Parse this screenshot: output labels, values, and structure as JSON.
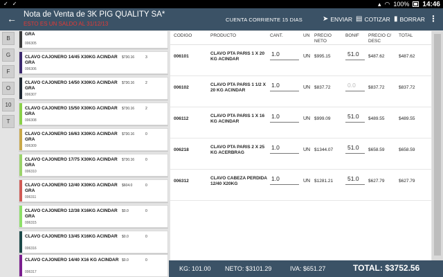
{
  "status_bar": {
    "battery": "100%",
    "time": "14:46"
  },
  "header": {
    "title": "Nota de Venta de 3K PIG QUALITY SA*",
    "subtitle": "ESTO ES UN SALDO AL 31/12/13",
    "cuenta": "CUENTA CORRIENTE 15 DIAS",
    "actions": {
      "enviar": "ENVIAR",
      "cotizar": "COTIZAR",
      "borrar": "BORRAR"
    }
  },
  "letters": [
    "B",
    "G",
    "F",
    "O",
    "10",
    "T"
  ],
  "products": [
    {
      "name": "GRA",
      "code": "006305",
      "price": "",
      "qty": "",
      "color": "#3b3b3b"
    },
    {
      "name": "CLAVO CAJONERO 14/45 X30KG ACINDAR GRA",
      "code": "006306",
      "price": "$730.16",
      "qty": "3",
      "color": "#3c2a6e"
    },
    {
      "name": "CLAVO CAJONERO 14/50 X30KG ACINDAR GRA",
      "code": "006307",
      "price": "$730.16",
      "qty": "2",
      "color": "#1f2833"
    },
    {
      "name": "CLAVO CAJONERO 15/50 X30KG ACINDAR GRA",
      "code": "006308",
      "price": "$730.16",
      "qty": "2",
      "color": "#8bd04a"
    },
    {
      "name": "CLAVO CAJONERO 16/63 X30KG ACINDAR GRA",
      "code": "006309",
      "price": "$730.16",
      "qty": "0",
      "color": "#c8a84a"
    },
    {
      "name": "CLAVO CAJONERO 17/75 X30KG ACINDAR GRA",
      "code": "006310",
      "price": "$730.16",
      "qty": "0",
      "color": "#9bd36b"
    },
    {
      "name": "CLAVO CAJONERO 12/40 X30KG ACINDAR GRA",
      "code": "006311",
      "price": "$604.0",
      "qty": "0",
      "color": "#d05b55"
    },
    {
      "name": "CLAVO CAJONERO 12/38 X16KG ACINDAR GRA",
      "code": "006315",
      "price": "$0.0",
      "qty": "0",
      "color": "#8ee06a"
    },
    {
      "name": "CLAVO CAJONERO 13/45 X16KG ACINDAR",
      "code": "006316",
      "price": "$0.0",
      "qty": "0",
      "color": "#1d4a4a"
    },
    {
      "name": "CLAVO CAJONERO 14/40 X16 KG ACINDAR",
      "code": "006317",
      "price": "$0.0",
      "qty": "0",
      "color": "#7b1f8f"
    }
  ],
  "table": {
    "headers": {
      "codigo": "CODIGO",
      "producto": "PRODUCTO",
      "cant": "CANT.",
      "un": "UN",
      "precio_neto": "PRECIO NETO",
      "bonif": "BONIF",
      "precio_desc": "PRECIO C/ DESC",
      "total": "TOTAL"
    },
    "rows": [
      {
        "code": "006101",
        "product": "CLAVO PTA PARIS 1 X 20 KG ACINDAR",
        "qty": "1.0",
        "un": "UN",
        "neto": "$995.15",
        "bonif": "51.0",
        "desc": "$487.62",
        "total": "$487.62"
      },
      {
        "code": "006102",
        "product": "CLAVO PTA PARIS 1 1/2 X 20 KG ACINDAR",
        "qty": "1.0",
        "un": "UN",
        "neto": "$837.72",
        "bonif": "0.0",
        "desc": "$837.72",
        "total": "$837.72"
      },
      {
        "code": "006112",
        "product": "CLAVO PTA PARIS 1 X 16 KG ACINDAR",
        "qty": "1.0",
        "un": "UN",
        "neto": "$999.09",
        "bonif": "51.0",
        "desc": "$489.55",
        "total": "$489.55"
      },
      {
        "code": "006218",
        "product": "CLAVO PTA PARIS 2 X 25 KG ACERBRAG",
        "qty": "1.0",
        "un": "UN",
        "neto": "$1344.07",
        "bonif": "51.0",
        "desc": "$658.59",
        "total": "$658.59"
      },
      {
        "code": "006312",
        "product": "CLAVO CABEZA PERDIDA 12/40 X20KG",
        "qty": "1.0",
        "un": "UN",
        "neto": "$1281.21",
        "bonif": "51.0",
        "desc": "$627.79",
        "total": "$627.79"
      }
    ]
  },
  "footer": {
    "kg": "KG: 101.00",
    "neto": "NETO: $3101.29",
    "iva": "IVA: $651.27",
    "total": "TOTAL: $3752.56"
  }
}
